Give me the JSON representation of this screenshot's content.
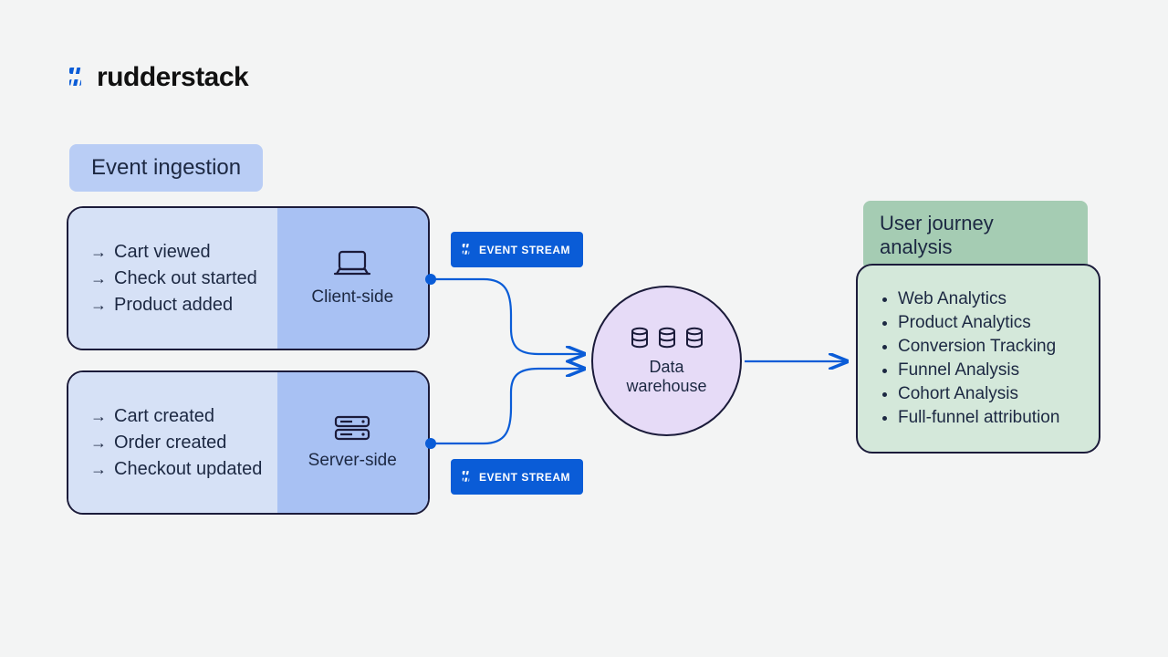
{
  "brand": {
    "name": "rudderstack"
  },
  "ingestion": {
    "title": "Event ingestion",
    "client": {
      "label": "Client-side",
      "events": [
        "Cart viewed",
        "Check out started",
        "Product added"
      ]
    },
    "server": {
      "label": "Server-side",
      "events": [
        "Cart created",
        "Order created",
        "Checkout updated"
      ]
    }
  },
  "stream_badge": "EVENT STREAM",
  "warehouse": {
    "label_line1": "Data",
    "label_line2": "warehouse"
  },
  "analysis": {
    "title": "User journey analysis",
    "items": [
      "Web Analytics",
      "Product Analytics",
      "Conversion Tracking",
      "Funnel Analysis",
      "Cohort Analysis",
      "Full-funnel attribution"
    ]
  }
}
